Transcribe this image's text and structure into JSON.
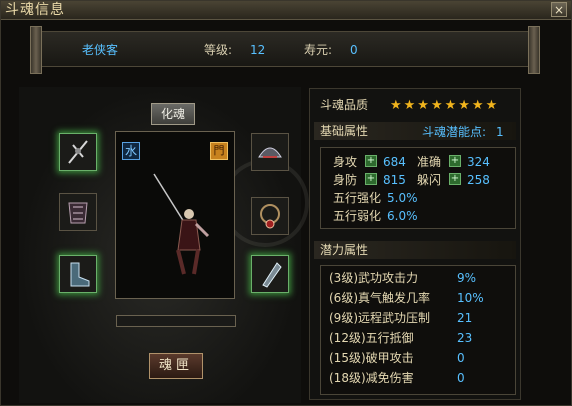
{
  "window": {
    "title": "斗魂信息",
    "close_label": "×"
  },
  "header": {
    "name": "老侠客",
    "level_label": "等级:",
    "level_value": "12",
    "age_label": "寿元:",
    "age_value": "0"
  },
  "left": {
    "huahun_label": "化魂",
    "element_tag": "水",
    "sect_tag": "門",
    "soul_button": "魂匣"
  },
  "right": {
    "quality_label": "斗魂品质",
    "star_count": 8,
    "base_title": "基础属性",
    "potential_points_label": "斗魂潜能点:",
    "potential_points_value": "1",
    "stats": {
      "attack_label": "身攻",
      "attack_value": "684",
      "accuracy_label": "准确",
      "accuracy_value": "324",
      "defense_label": "身防",
      "defense_value": "815",
      "dodge_label": "躲闪",
      "dodge_value": "258",
      "wx_strengthen_label": "五行强化",
      "wx_strengthen_value": "5.0%",
      "wx_weaken_label": "五行弱化",
      "wx_weaken_value": "6.0%"
    },
    "potential_title": "潜力属性",
    "potential": [
      {
        "label": "(3级)武功攻击力",
        "value": "9%"
      },
      {
        "label": "(6级)真气触发几率",
        "value": "10%"
      },
      {
        "label": "(9级)远程武功压制",
        "value": "21"
      },
      {
        "label": "(12级)五行抵御",
        "value": "23"
      },
      {
        "label": "(15级)破甲攻击",
        "value": "0"
      },
      {
        "label": "(18级)减免伤害",
        "value": "0"
      }
    ]
  },
  "colors": {
    "star": "#f1b41d",
    "accent_blue": "#58c0ff",
    "text": "#e4d8b2",
    "glow_green": "#6ab06a"
  }
}
